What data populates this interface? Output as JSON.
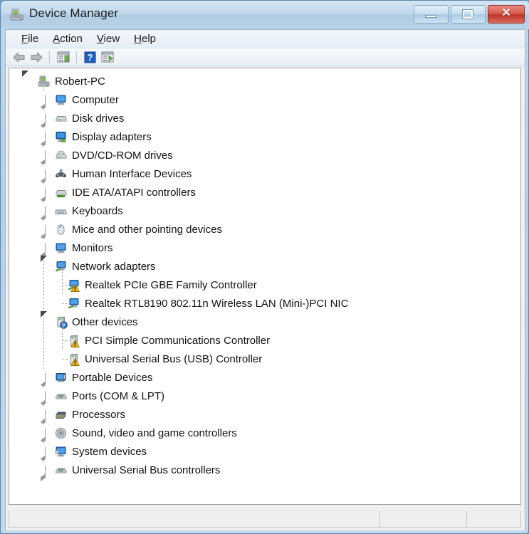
{
  "window": {
    "title": "Device Manager",
    "icon": "device-manager-icon",
    "buttons": {
      "minimize": "Minimize",
      "maximize": "Maximize",
      "close": "Close",
      "close_glyph": "✕"
    }
  },
  "menubar": {
    "items": [
      {
        "label": "File",
        "accel": "F"
      },
      {
        "label": "Action",
        "accel": "A"
      },
      {
        "label": "View",
        "accel": "V"
      },
      {
        "label": "Help",
        "accel": "H"
      }
    ]
  },
  "toolbar": {
    "items": [
      {
        "name": "back-arrow-icon",
        "label": "Back",
        "enabled": false
      },
      {
        "name": "forward-arrow-icon",
        "label": "Forward",
        "enabled": false
      },
      {
        "name": "show-console-tree-icon",
        "label": "Show/Hide console tree",
        "enabled": true
      },
      {
        "name": "help-icon",
        "label": "Help",
        "enabled": true
      },
      {
        "name": "properties-icon",
        "label": "Properties",
        "enabled": true
      }
    ]
  },
  "tree": {
    "root": {
      "label": "Robert-PC",
      "icon": "computer-root-icon",
      "expanded": true
    },
    "nodes": [
      {
        "label": "Computer",
        "icon": "computer-icon",
        "expanded": false,
        "children": []
      },
      {
        "label": "Disk drives",
        "icon": "disk-drive-icon",
        "expanded": false,
        "children": []
      },
      {
        "label": "Display adapters",
        "icon": "display-adapter-icon",
        "expanded": false,
        "children": []
      },
      {
        "label": "DVD/CD-ROM drives",
        "icon": "dvd-drive-icon",
        "expanded": false,
        "children": []
      },
      {
        "label": "Human Interface Devices",
        "icon": "hid-icon",
        "expanded": false,
        "children": []
      },
      {
        "label": "IDE ATA/ATAPI controllers",
        "icon": "ide-controller-icon",
        "expanded": false,
        "children": []
      },
      {
        "label": "Keyboards",
        "icon": "keyboard-icon",
        "expanded": false,
        "children": []
      },
      {
        "label": "Mice and other pointing devices",
        "icon": "mouse-icon",
        "expanded": false,
        "children": []
      },
      {
        "label": "Monitors",
        "icon": "monitor-icon",
        "expanded": false,
        "children": []
      },
      {
        "label": "Network adapters",
        "icon": "network-adapter-icon",
        "expanded": true,
        "children": [
          {
            "label": "Realtek PCIe GBE Family Controller",
            "icon": "network-adapter-icon",
            "badge": "warning"
          },
          {
            "label": "Realtek RTL8190 802.11n Wireless LAN (Mini-)PCI NIC",
            "icon": "network-adapter-icon",
            "badge": "none"
          }
        ]
      },
      {
        "label": "Other devices",
        "icon": "unknown-device-icon",
        "expanded": true,
        "badge": "question",
        "children": [
          {
            "label": "PCI Simple Communications Controller",
            "icon": "unknown-device-icon",
            "badge": "warning"
          },
          {
            "label": "Universal Serial Bus (USB) Controller",
            "icon": "unknown-device-icon",
            "badge": "warning"
          }
        ]
      },
      {
        "label": "Portable Devices",
        "icon": "portable-device-icon",
        "expanded": false,
        "children": []
      },
      {
        "label": "Ports (COM & LPT)",
        "icon": "port-icon",
        "expanded": false,
        "children": []
      },
      {
        "label": "Processors",
        "icon": "processor-icon",
        "expanded": false,
        "children": []
      },
      {
        "label": "Sound, video and game controllers",
        "icon": "sound-icon",
        "expanded": false,
        "children": []
      },
      {
        "label": "System devices",
        "icon": "system-device-icon",
        "expanded": false,
        "children": []
      },
      {
        "label": "Universal Serial Bus controllers",
        "icon": "usb-controller-icon",
        "expanded": false,
        "children": []
      }
    ]
  },
  "statusbar": {
    "cells": [
      "",
      "",
      ""
    ]
  },
  "colors": {
    "accent": "#4a90c4",
    "warning": "#ffc20e",
    "question": "#2f7fd0",
    "close_button": "#c0392b",
    "frame": "#b4d0e7"
  }
}
